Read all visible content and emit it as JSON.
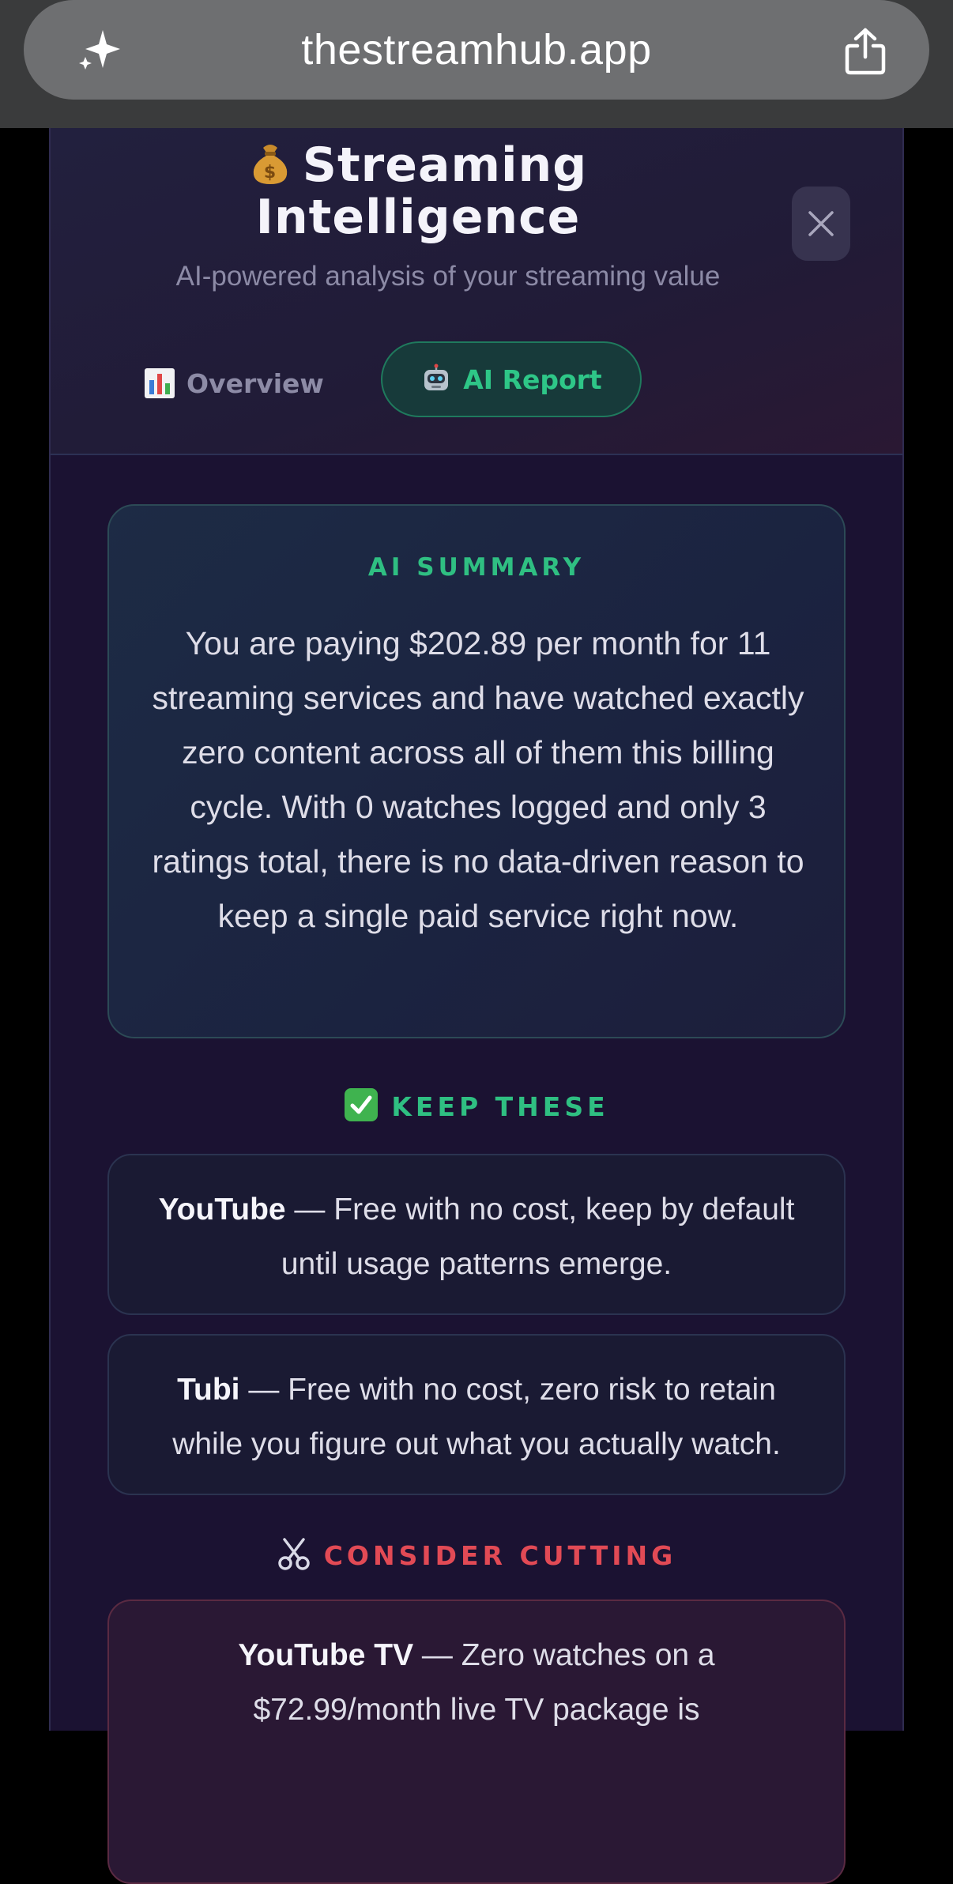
{
  "browser": {
    "url": "thestreamhub.app",
    "left_icon": "sparkle-icon",
    "right_icon": "share-icon"
  },
  "header": {
    "title_emoji": "money-bag-icon",
    "title_line1": "Streaming",
    "title_line2": "Intelligence",
    "subtitle": "AI-powered analysis of your streaming value",
    "close_icon": "close-icon"
  },
  "tabs": [
    {
      "label": "Overview",
      "icon": "bar-chart-icon",
      "active": false
    },
    {
      "label": "AI Report",
      "icon": "robot-icon",
      "active": true
    }
  ],
  "summary": {
    "heading": "AI SUMMARY",
    "text": "You are paying $202.89 per month for 11 streaming services and have watched exactly zero content across all of them this billing cycle. With 0 watches logged and only 3 ratings total, there is no data-driven reason to keep a single paid service right now."
  },
  "keep": {
    "heading": "KEEP THESE",
    "icon": "check-box-icon",
    "items": [
      {
        "name": "YouTube",
        "text": " — Free with no cost, keep by default until usage patterns emerge."
      },
      {
        "name": "Tubi",
        "text": " — Free with no cost, zero risk to retain while you figure out what you actually watch."
      }
    ]
  },
  "cut": {
    "heading": "CONSIDER CUTTING",
    "icon": "scissors-icon",
    "items": [
      {
        "name": "YouTube TV",
        "text": " — Zero watches on a $72.99/month live TV package is"
      }
    ]
  },
  "colors": {
    "accent_green": "#2fbf82",
    "accent_red": "#e24a55",
    "panel_bg": "#1b1232"
  }
}
